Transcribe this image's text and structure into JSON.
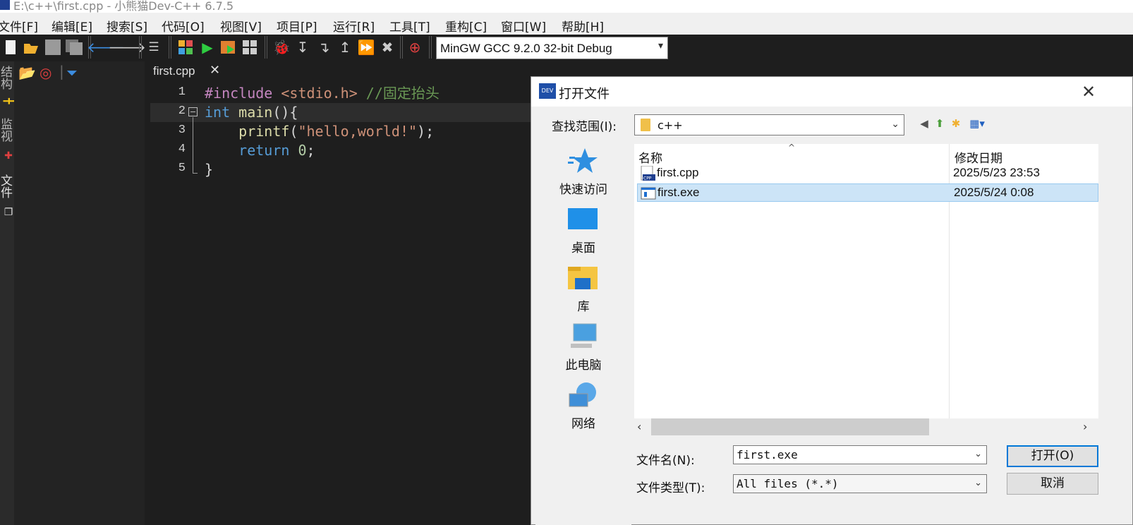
{
  "window": {
    "title": "E:\\c++\\first.cpp - 小熊猫Dev-C++ 6.7.5"
  },
  "menu": [
    "文件[F]",
    "编辑[E]",
    "搜索[S]",
    "代码[O]",
    "视图[V]",
    "项目[P]",
    "运行[R]",
    "工具[T]",
    "重构[C]",
    "窗口[W]",
    "帮助[H]"
  ],
  "toolbar": {
    "compiler_selected": "MinGW GCC 9.2.0 32-bit Debug"
  },
  "side_tabs": [
    "结构",
    "监视",
    "文件"
  ],
  "editor": {
    "tab_label": "first.cpp",
    "tab_close": "✕",
    "lines": [
      {
        "num": "1",
        "parts": [
          {
            "t": "#include ",
            "c": "kw-pre"
          },
          {
            "t": "<stdio.h>",
            "c": "kw-inc"
          },
          {
            "t": " //固定抬头",
            "c": "kw-com"
          }
        ]
      },
      {
        "num": "2",
        "parts": [
          {
            "t": "int",
            "c": "kw-type"
          },
          {
            "t": " ",
            "c": "kw-pl"
          },
          {
            "t": "main",
            "c": "kw-fn"
          },
          {
            "t": "(){",
            "c": "kw-pl"
          }
        ]
      },
      {
        "num": "3",
        "parts": [
          {
            "t": "    ",
            "c": "kw-pl"
          },
          {
            "t": "printf",
            "c": "kw-fn"
          },
          {
            "t": "(",
            "c": "kw-pl"
          },
          {
            "t": "\"hello,world!\"",
            "c": "kw-str"
          },
          {
            "t": ");",
            "c": "kw-pl"
          }
        ]
      },
      {
        "num": "4",
        "parts": [
          {
            "t": "    ",
            "c": "kw-pl"
          },
          {
            "t": "return",
            "c": "kw-type"
          },
          {
            "t": " ",
            "c": "kw-pl"
          },
          {
            "t": "0",
            "c": "kw-num"
          },
          {
            "t": ";",
            "c": "kw-pl"
          }
        ]
      },
      {
        "num": "5",
        "parts": [
          {
            "t": "}",
            "c": "kw-pl"
          }
        ]
      }
    ]
  },
  "dialog": {
    "title": "打开文件",
    "icon_text": "DEV",
    "close": "✕",
    "look_in_label": "查找范围(I):",
    "look_in_value": "c++",
    "places": [
      "快速访问",
      "桌面",
      "库",
      "此电脑",
      "网络"
    ],
    "columns": {
      "name": "名称",
      "date": "修改日期"
    },
    "files": [
      {
        "name": "first.cpp",
        "date": "2025/5/23 23:53",
        "icon": "cpp-file-icon",
        "selected": false
      },
      {
        "name": "first.exe",
        "date": "2025/5/24 0:08",
        "icon": "exe-file-icon",
        "selected": true
      }
    ],
    "filename_label": "文件名(N):",
    "filename_value": "first.exe",
    "filetype_label": "文件类型(T):",
    "filetype_value": "All files (*.*)",
    "open_button": "打开(O)",
    "cancel_button": "取消"
  }
}
